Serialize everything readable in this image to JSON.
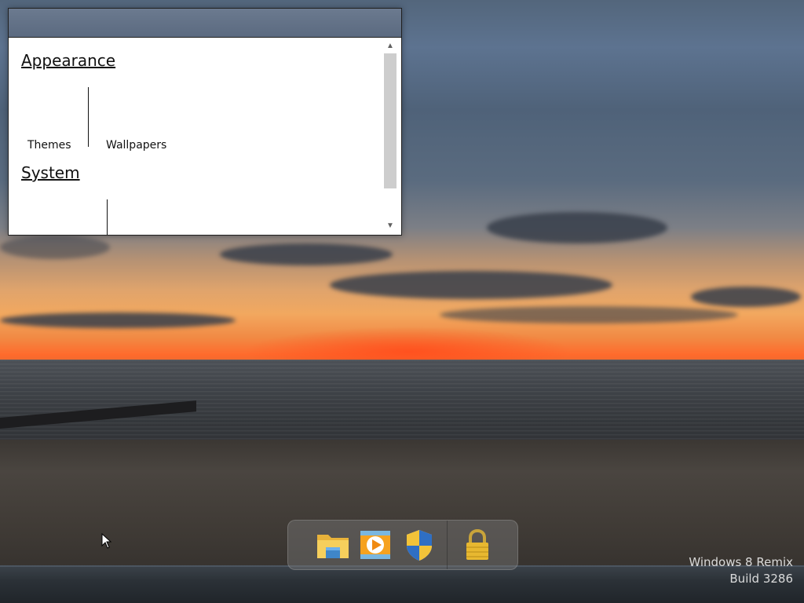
{
  "window": {
    "sections": [
      {
        "title": "Appearance",
        "items": [
          {
            "label": "Themes"
          },
          {
            "label": "Wallpapers"
          }
        ]
      },
      {
        "title": "System",
        "items": []
      }
    ],
    "scrollbar": {
      "up_glyph": "▲",
      "down_glyph": "▼"
    }
  },
  "taskbar": {
    "icons": [
      {
        "name": "file-explorer-icon"
      },
      {
        "name": "media-player-icon"
      },
      {
        "name": "security-shield-icon"
      },
      {
        "name": "lock-icon"
      }
    ]
  },
  "watermark": {
    "line1": "Windows 8 Remix",
    "line2": "Build 3286"
  },
  "colors": {
    "titlebar": "#5f6e84",
    "accent_sunset": "#f2a85f"
  }
}
